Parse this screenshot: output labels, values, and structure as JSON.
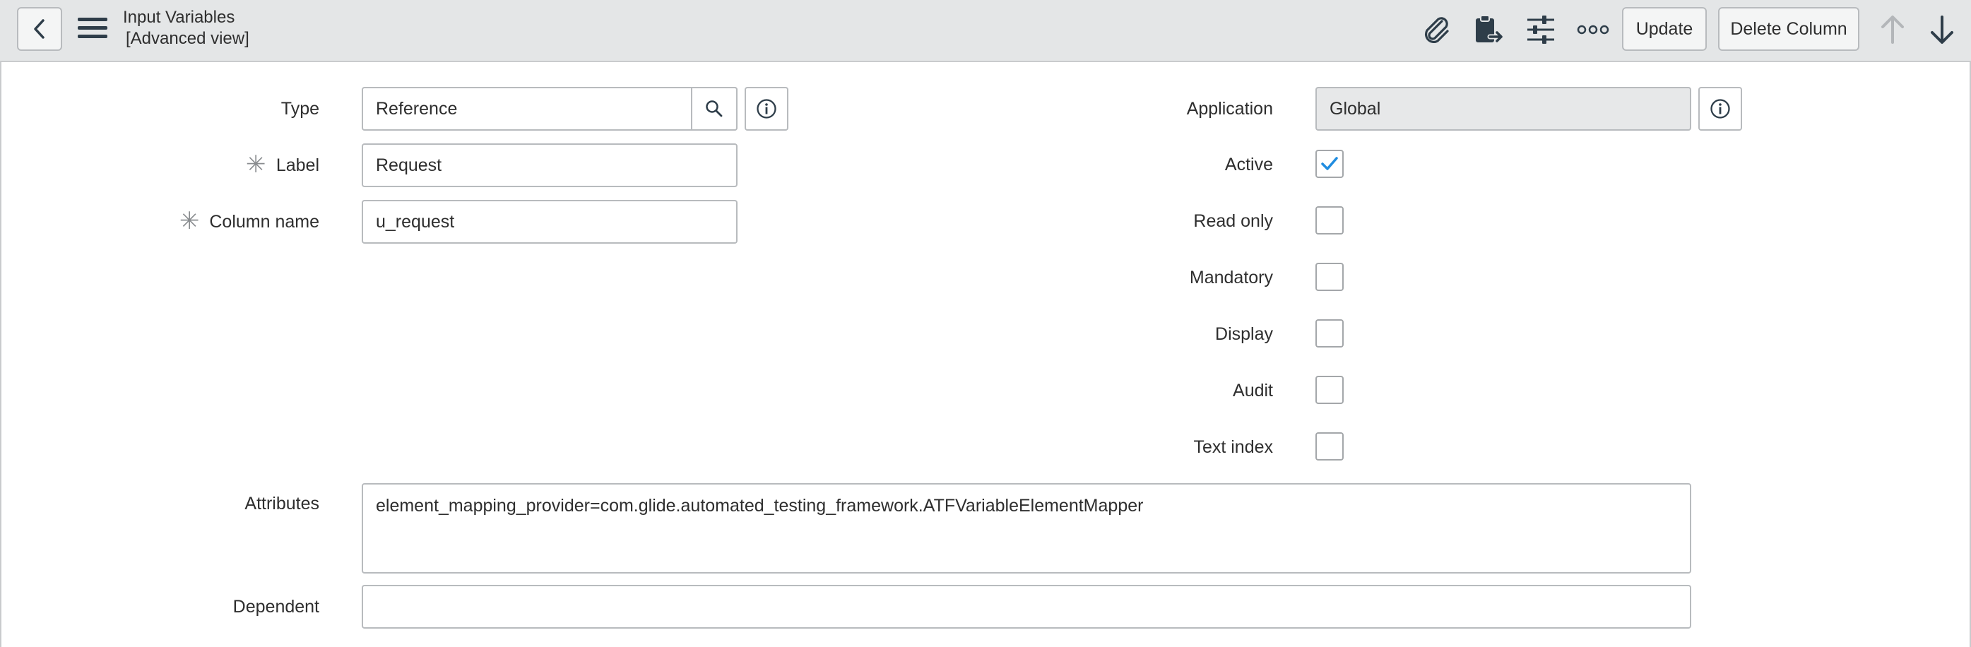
{
  "header": {
    "title": "Input Variables",
    "subtitle": "[Advanced view]",
    "update_label": "Update",
    "delete_label": "Delete Column",
    "icons": [
      "back-icon",
      "hamburger-menu-icon",
      "paperclip-icon",
      "clipboard-export-icon",
      "sliders-icon",
      "more-options-icon",
      "arrow-up-icon",
      "arrow-down-icon"
    ]
  },
  "form": {
    "type": {
      "label": "Type",
      "value": "Reference"
    },
    "label": {
      "label": "Label",
      "value": "Request",
      "required": true
    },
    "column_name": {
      "label": "Column name",
      "value": "u_request",
      "required": true
    },
    "application": {
      "label": "Application",
      "value": "Global"
    },
    "active": {
      "label": "Active",
      "checked": true
    },
    "read_only": {
      "label": "Read only",
      "checked": false
    },
    "mandatory": {
      "label": "Mandatory",
      "checked": false
    },
    "display": {
      "label": "Display",
      "checked": false
    },
    "audit": {
      "label": "Audit",
      "checked": false
    },
    "text_index": {
      "label": "Text index",
      "checked": false
    },
    "attributes": {
      "label": "Attributes",
      "value": "element_mapping_provider=com.glide.automated_testing_framework.ATFVariableElementMapper"
    },
    "dependent": {
      "label": "Dependent",
      "value": ""
    }
  },
  "colors": {
    "header_bg": "#e4e6e7",
    "checkmark": "#1f8ce0",
    "icon_dark": "#2e3d49",
    "disabled_arrow": "#b3b6b9"
  }
}
